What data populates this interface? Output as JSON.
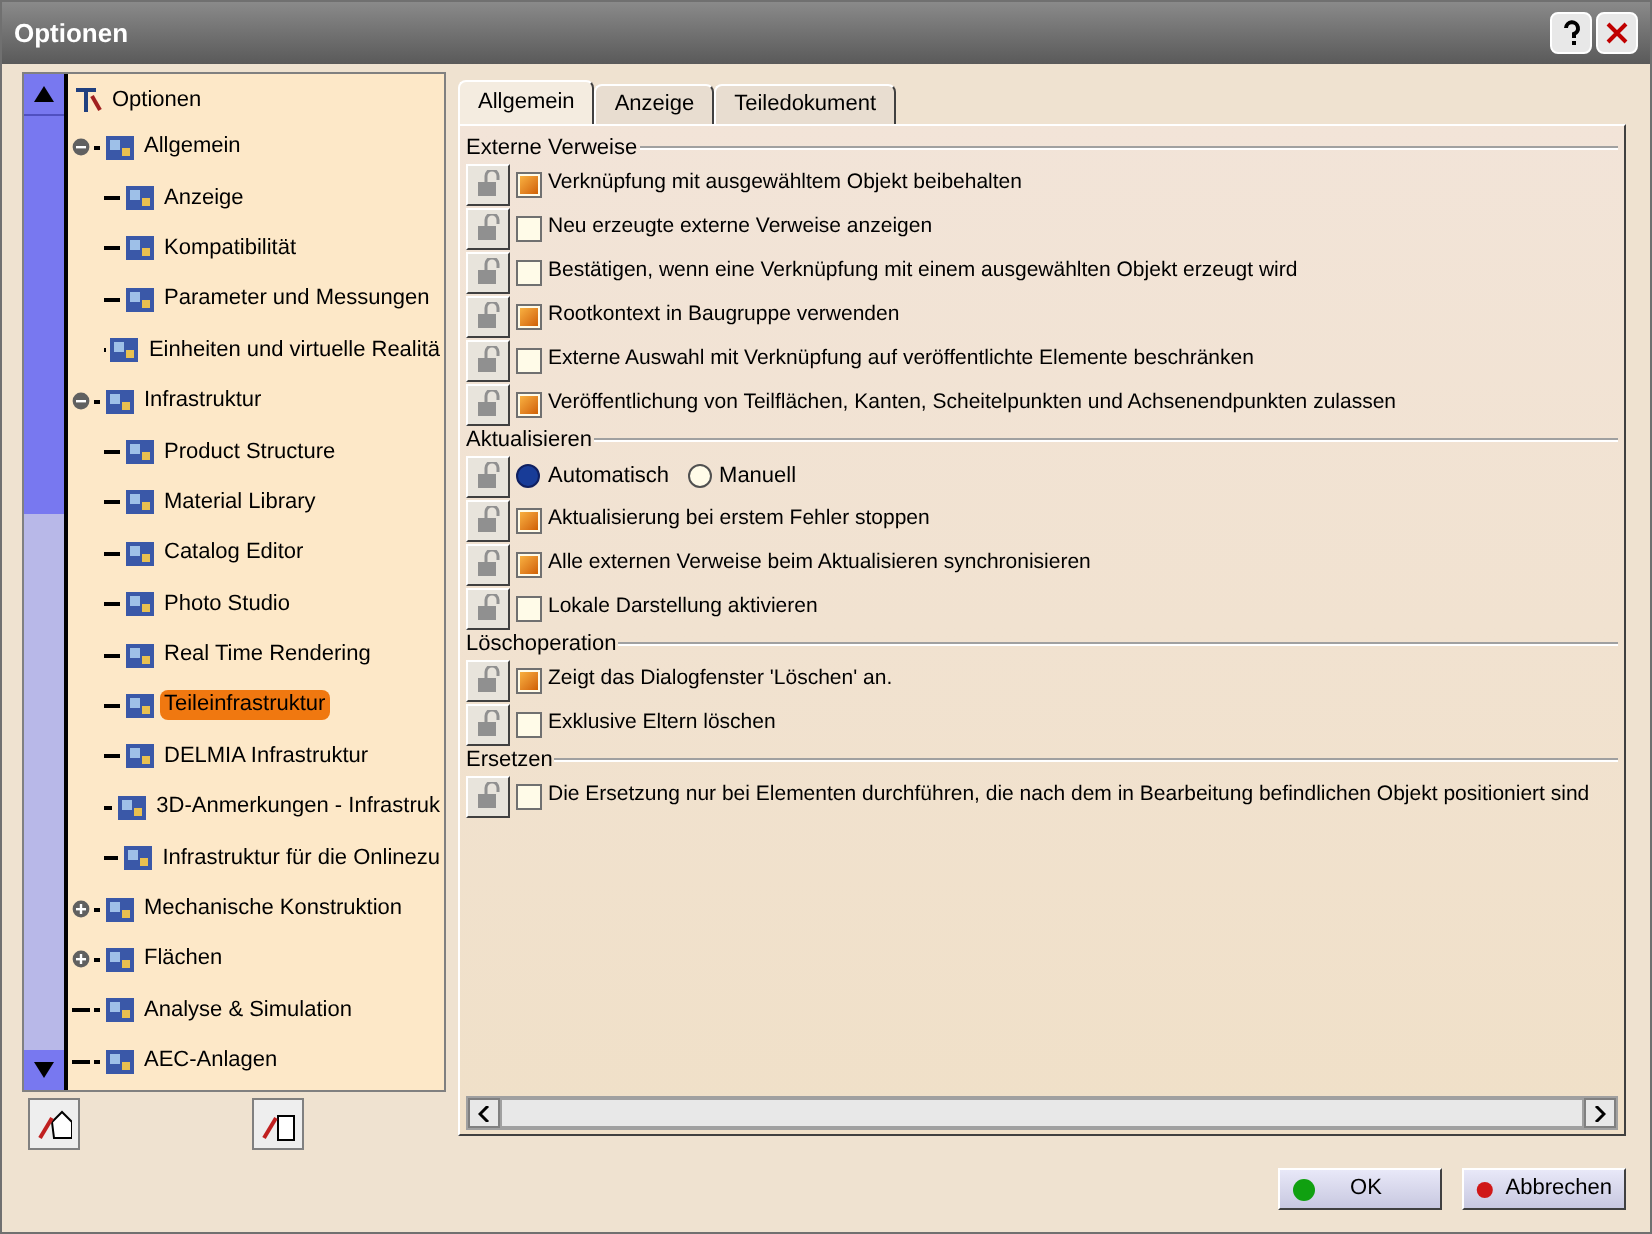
{
  "window": {
    "title": "Optionen"
  },
  "tree": {
    "label": "Optionen",
    "selected": false,
    "children": [
      {
        "label": "Allgemein",
        "expanded": true,
        "selected": false,
        "children": [
          {
            "label": "Anzeige",
            "selected": false
          },
          {
            "label": "Kompatibilität",
            "selected": false
          },
          {
            "label": "Parameter und Messungen",
            "selected": false
          },
          {
            "label": "Einheiten und virtuelle Realitä",
            "selected": false
          }
        ]
      },
      {
        "label": "Infrastruktur",
        "expanded": true,
        "selected": false,
        "children": [
          {
            "label": "Product Structure",
            "selected": false
          },
          {
            "label": "Material Library",
            "selected": false
          },
          {
            "label": "Catalog Editor",
            "selected": false
          },
          {
            "label": "Photo Studio",
            "selected": false
          },
          {
            "label": "Real Time Rendering",
            "selected": false
          },
          {
            "label": "Teileinfrastruktur",
            "selected": true
          },
          {
            "label": "DELMIA Infrastruktur",
            "selected": false
          },
          {
            "label": "3D-Anmerkungen - Infrastruk",
            "selected": false
          },
          {
            "label": "Infrastruktur für die Onlinezu",
            "selected": false
          }
        ]
      },
      {
        "label": "Mechanische Konstruktion",
        "expanded": false,
        "selected": false
      },
      {
        "label": "Flächen",
        "expanded": false,
        "selected": false
      },
      {
        "label": "Analyse & Simulation",
        "selected": false
      },
      {
        "label": "AEC-Anlagen",
        "selected": false
      }
    ]
  },
  "tabs": [
    {
      "label": "Allgemein",
      "selected": true
    },
    {
      "label": "Anzeige",
      "selected": false
    },
    {
      "label": "Teiledokument",
      "selected": false
    }
  ],
  "sections": [
    {
      "title": "Externe Verweise",
      "rows": [
        {
          "kind": "checkbox",
          "label": "Verknüpfung mit ausgewähltem Objekt beibehalten",
          "checked": true
        },
        {
          "kind": "checkbox",
          "label": "Neu erzeugte externe Verweise anzeigen",
          "checked": false
        },
        {
          "kind": "checkbox",
          "label": "Bestätigen, wenn eine Verknüpfung mit einem ausgewählten Objekt erzeugt wird",
          "checked": false
        },
        {
          "kind": "checkbox",
          "label": "Rootkontext in Baugruppe verwenden",
          "checked": true
        },
        {
          "kind": "checkbox",
          "label": "Externe Auswahl mit Verknüpfung auf veröffentlichte Elemente beschränken",
          "checked": false
        },
        {
          "kind": "checkbox",
          "label": "Veröffentlichung von Teilflächen, Kanten, Scheitelpunkten und Achsenendpunkten zulassen",
          "checked": true
        }
      ]
    },
    {
      "title": "Aktualisieren",
      "rows": [
        {
          "kind": "radio",
          "options": [
            {
              "label": "Automatisch",
              "selected": true
            },
            {
              "label": "Manuell",
              "selected": false
            }
          ]
        },
        {
          "kind": "checkbox",
          "label": "Aktualisierung bei erstem Fehler stoppen",
          "checked": true
        },
        {
          "kind": "checkbox",
          "label": "Alle externen Verweise beim Aktualisieren synchronisieren",
          "checked": true
        },
        {
          "kind": "checkbox",
          "label": "Lokale Darstellung aktivieren",
          "checked": false
        }
      ]
    },
    {
      "title": "Löschoperation",
      "rows": [
        {
          "kind": "checkbox",
          "label": "Zeigt das Dialogfenster 'Löschen' an.",
          "checked": true
        },
        {
          "kind": "checkbox",
          "label": "Exklusive Eltern löschen",
          "checked": false
        }
      ]
    },
    {
      "title": "Ersetzen",
      "rows": [
        {
          "kind": "checkbox",
          "label": "Die Ersetzung nur bei Elementen durchführen, die nach dem in Bearbeitung befindlichen Objekt positioniert sind",
          "checked": false
        }
      ]
    }
  ],
  "buttons": [
    {
      "label": "OK",
      "kind": "ok"
    },
    {
      "label": "Abbrechen",
      "kind": "cancel"
    }
  ]
}
